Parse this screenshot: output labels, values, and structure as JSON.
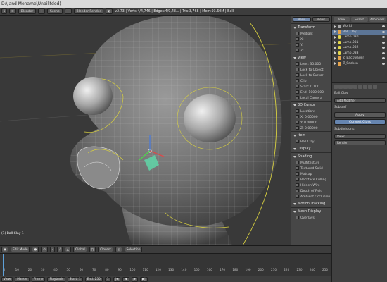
{
  "window": {
    "title": "D:\\ and Mename\\Unbilitded)"
  },
  "info_header": {
    "field1": "Blender",
    "field2": "Scene",
    "render_engine": "Blender Render",
    "stats": "v2.73 | Verts:4/4,746 | Edges:4/9,48... | Tris:3,768 | Mem:93.60M | Ball"
  },
  "viewport": {
    "object_label": "(1) Ball.Clay 1"
  },
  "npanel": {
    "tabs": [
      "Basic",
      "Views"
    ],
    "sections": [
      {
        "title": "Transform",
        "rows": [
          "Median:",
          "X:",
          "Y:",
          "Z:"
        ]
      },
      {
        "title": "View",
        "rows": [
          "Lens: 35.000",
          "Lock to Object:"
        ]
      },
      {
        "title": "",
        "rows": [
          "Lock to Cursor",
          "Clip:",
          "Start: 0.100",
          "End: 1000.000",
          "Local Camera"
        ]
      },
      {
        "title": "3D Cursor",
        "rows": [
          "Location:",
          "X: 0.00000",
          "Y: 0.00000",
          "Z: 0.00000"
        ]
      },
      {
        "title": "Item",
        "rows": [
          "Ball.Clay"
        ]
      },
      {
        "title": "Display",
        "rows": []
      },
      {
        "title": "Shading",
        "rows": [
          "Multitexture",
          "Textured Solid",
          "Matcap",
          "Backface Culling",
          "Hidden Wire",
          "Depth of Field",
          "Ambient Occlusion"
        ]
      },
      {
        "title": "Motion Tracking",
        "rows": []
      },
      {
        "title": "Mesh Display",
        "rows": [
          "Overlays"
        ]
      }
    ]
  },
  "outliner": {
    "tabs": [
      "View",
      "Search",
      "All Scenes"
    ],
    "items": [
      {
        "name": "World",
        "icon": "world-icon",
        "selected": false
      },
      {
        "name": "Ball.Clay",
        "icon": "mesh-icon",
        "selected": true
      },
      {
        "name": "Lamp.030",
        "icon": "lamp-icon",
        "selected": false
      },
      {
        "name": "Lamp.031",
        "icon": "lamp-icon",
        "selected": false
      },
      {
        "name": "Lamp.032",
        "icon": "lamp-icon",
        "selected": false
      },
      {
        "name": "Lamp.033",
        "icon": "lamp-icon",
        "selected": false
      },
      {
        "name": "Z_Backwaden",
        "icon": "mesh-icon",
        "selected": false
      },
      {
        "name": "Z_Sachen",
        "icon": "mesh-icon",
        "selected": false
      }
    ]
  },
  "properties": {
    "object_name": "Ball.Clay",
    "add_modifier": "Add Modifier",
    "modifier_name": "Subsurf",
    "apply_label": "Apply",
    "convert_label": "Convert Class",
    "subdivisions_label": "Subdivisions:",
    "view_value": "View:",
    "render_value": "Render:"
  },
  "view_header": {
    "mode": "Edit Mode",
    "global": "Global",
    "pivot": "Closest",
    "select_label": "Selection"
  },
  "timeline": {
    "ticks": [
      "0",
      "10",
      "20",
      "30",
      "40",
      "50",
      "60",
      "70",
      "80",
      "90",
      "100",
      "110",
      "120",
      "130",
      "140",
      "150",
      "160",
      "170",
      "180",
      "190",
      "200",
      "210",
      "220",
      "230",
      "240",
      "250"
    ],
    "controls": [
      "View",
      "Marker",
      "Frame",
      "Playback",
      "Start: 1",
      "End: 250",
      "1"
    ]
  }
}
